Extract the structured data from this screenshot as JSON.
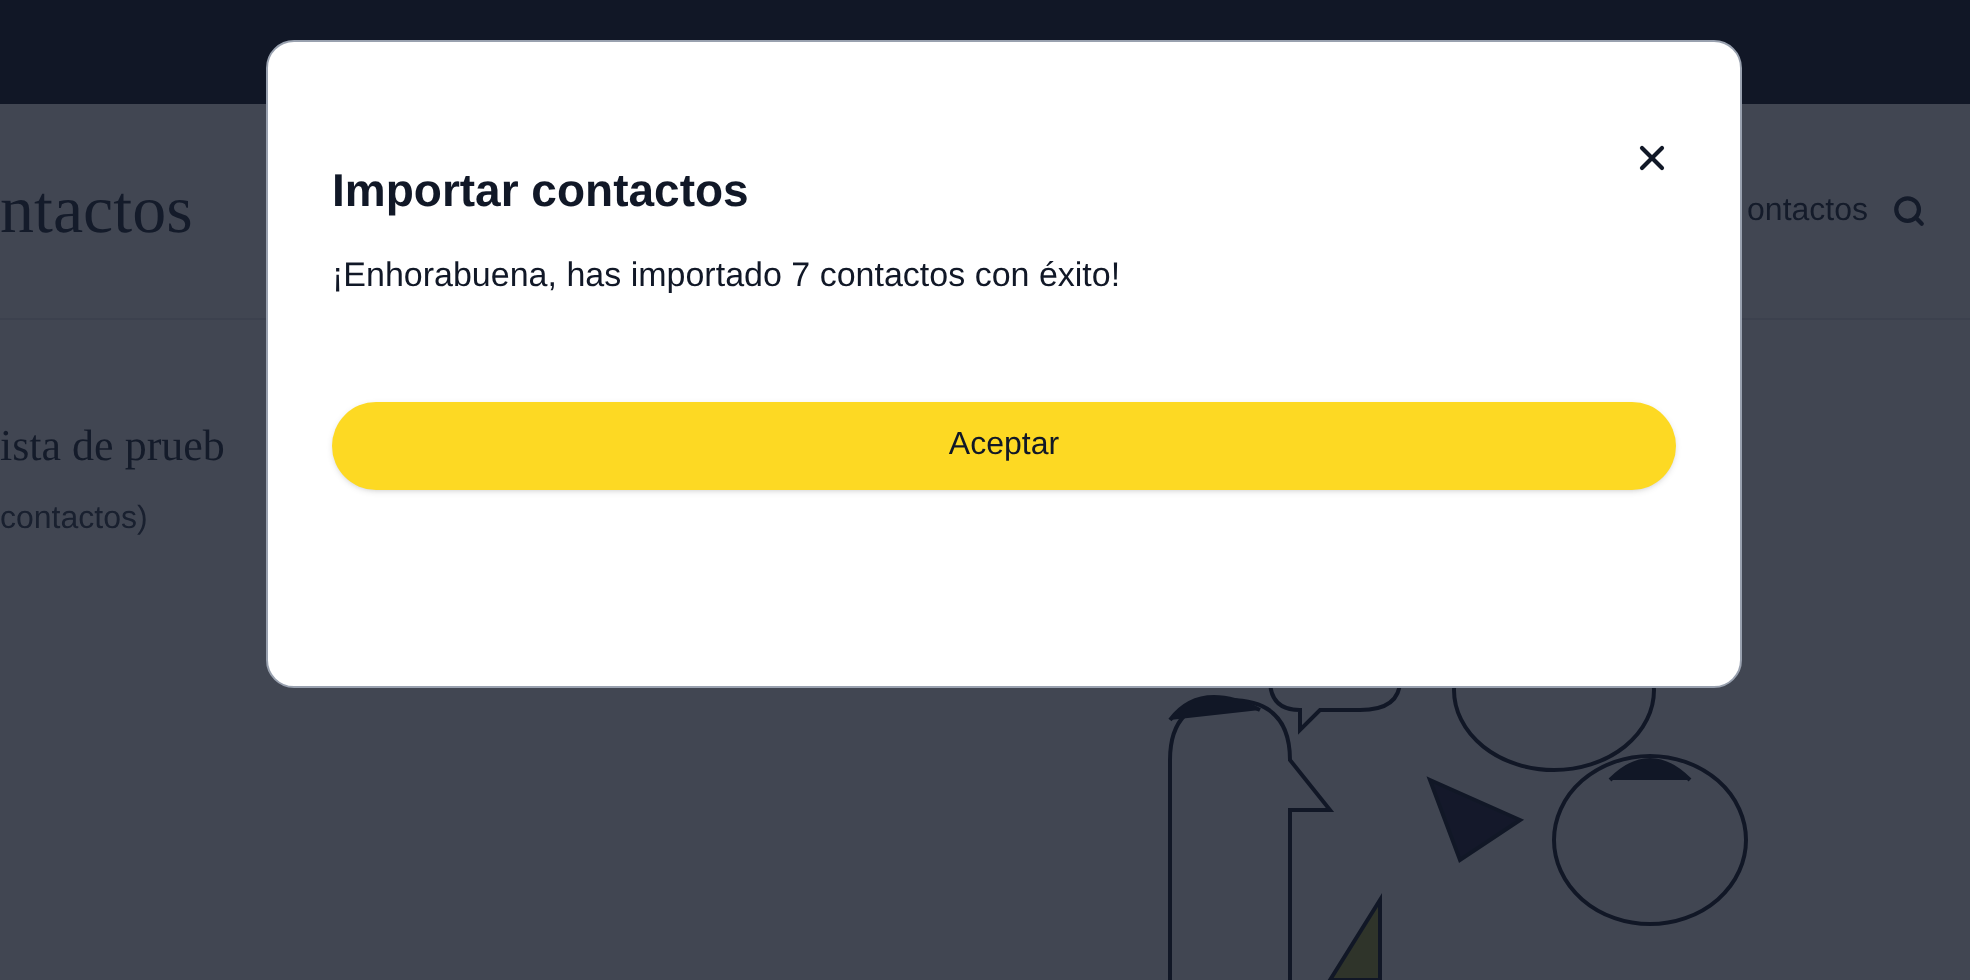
{
  "header": {
    "title": "ntactos",
    "nav_link": "ontactos"
  },
  "list": {
    "name": "ista de prueb",
    "count": "contactos)"
  },
  "dialog": {
    "title": "Importar contactos",
    "message": "¡Enhorabuena, has importado 7 contactos con éxito!",
    "button": "Aceptar"
  }
}
